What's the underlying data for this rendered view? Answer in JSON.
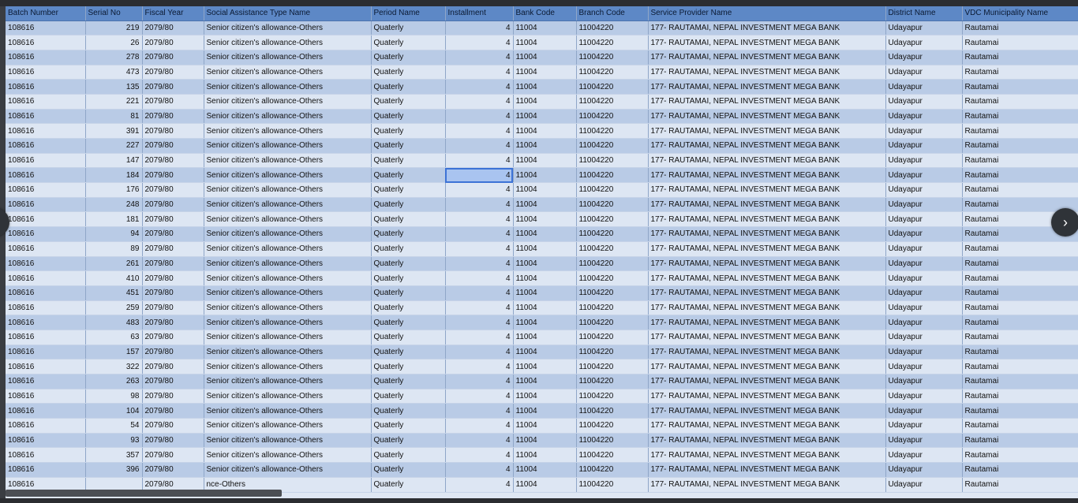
{
  "columns": [
    "Batch Number",
    "Serial No",
    "Fiscal Year",
    "Social Assistance Type Name",
    "Period Name",
    "Installment",
    "Bank Code",
    "Branch Code",
    "Service Provider Name",
    "District Name",
    "VDC Municipality Name"
  ],
  "constant": {
    "batch": "108616",
    "fiscal": "2079/80",
    "assistance": "Senior citizen's allowance-Others",
    "period": "Quaterly",
    "installment": "4",
    "bank": "11004",
    "branch": "11004220",
    "provider": "177- RAUTAMAI, NEPAL INVESTMENT MEGA BANK",
    "district": "Udayapur",
    "vdc": "Rautamai"
  },
  "serials": [
    "219",
    "26",
    "278",
    "473",
    "135",
    "221",
    "81",
    "391",
    "227",
    "147",
    "184",
    "176",
    "248",
    "181",
    "94",
    "89",
    "261",
    "410",
    "451",
    "259",
    "483",
    "63",
    "157",
    "322",
    "263",
    "98",
    "104",
    "54",
    "93",
    "357",
    "396",
    ""
  ],
  "last_row_assistance": "nce-Others",
  "selected_row_index": 10,
  "nav": {
    "next_glyph": "›",
    "prev_glyph": "‹"
  }
}
